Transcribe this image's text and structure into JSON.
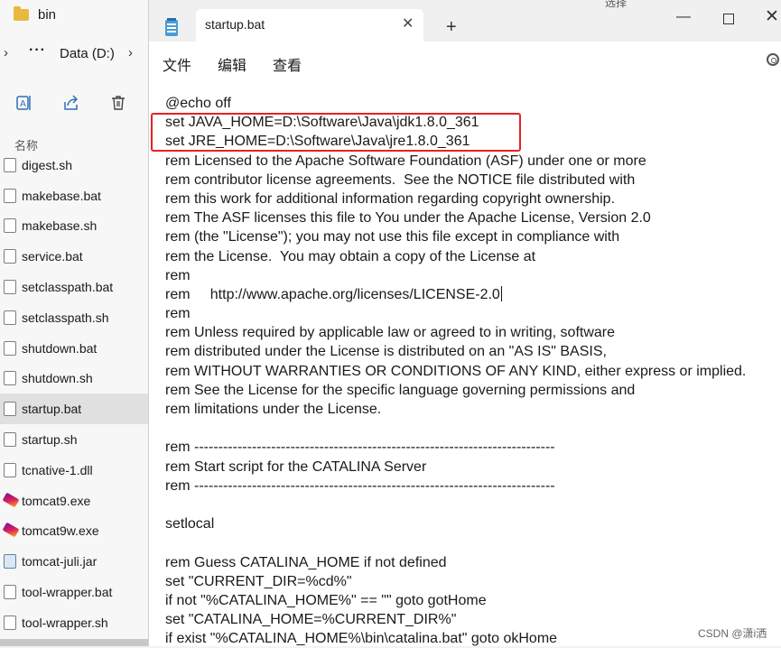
{
  "explorer": {
    "title": "bin",
    "breadcrumb": "Data (D:)",
    "breadcrumb_more": "···",
    "column_header": "名称",
    "selected_file": "startup.bat",
    "files": [
      {
        "name": "digest.sh",
        "type": "script"
      },
      {
        "name": "makebase.bat",
        "type": "script"
      },
      {
        "name": "makebase.sh",
        "type": "script"
      },
      {
        "name": "service.bat",
        "type": "script"
      },
      {
        "name": "setclasspath.bat",
        "type": "script"
      },
      {
        "name": "setclasspath.sh",
        "type": "script"
      },
      {
        "name": "shutdown.bat",
        "type": "script"
      },
      {
        "name": "shutdown.sh",
        "type": "script"
      },
      {
        "name": "startup.bat",
        "type": "script"
      },
      {
        "name": "startup.sh",
        "type": "script"
      },
      {
        "name": "tcnative-1.dll",
        "type": "dll"
      },
      {
        "name": "tomcat9.exe",
        "type": "exe"
      },
      {
        "name": "tomcat9w.exe",
        "type": "exe"
      },
      {
        "name": "tomcat-juli.jar",
        "type": "jar"
      },
      {
        "name": "tool-wrapper.bat",
        "type": "script"
      },
      {
        "name": "tool-wrapper.sh",
        "type": "script"
      }
    ]
  },
  "notepad": {
    "tab_title": "startup.bat",
    "peek_text": "选择",
    "menu": {
      "file": "文件",
      "edit": "编辑",
      "view": "查看"
    },
    "lines": [
      "@echo off",
      "set JAVA_HOME=D:\\Software\\Java\\jdk1.8.0_361",
      "set JRE_HOME=D:\\Software\\Java\\jre1.8.0_361",
      "rem Licensed to the Apache Software Foundation (ASF) under one or more",
      "rem contributor license agreements.  See the NOTICE file distributed with",
      "rem this work for additional information regarding copyright ownership.",
      "rem The ASF licenses this file to You under the Apache License, Version 2.0",
      "rem (the \"License\"); you may not use this file except in compliance with",
      "rem the License.  You may obtain a copy of the License at",
      "rem",
      "rem     http://www.apache.org/licenses/LICENSE-2.0",
      "rem",
      "rem Unless required by applicable law or agreed to in writing, software",
      "rem distributed under the License is distributed on an \"AS IS\" BASIS,",
      "rem WITHOUT WARRANTIES OR CONDITIONS OF ANY KIND, either express or implied.",
      "rem See the License for the specific language governing permissions and",
      "rem limitations under the License.",
      "",
      "rem ---------------------------------------------------------------------------",
      "rem Start script for the CATALINA Server",
      "rem ---------------------------------------------------------------------------",
      "",
      "setlocal",
      "",
      "rem Guess CATALINA_HOME if not defined",
      "set \"CURRENT_DIR=%cd%\"",
      "if not \"%CATALINA_HOME%\" == \"\" goto gotHome",
      "set \"CATALINA_HOME=%CURRENT_DIR%\"",
      "if exist \"%CATALINA_HOME%\\bin\\catalina.bat\" goto okHome"
    ],
    "caret_line": 10
  },
  "watermark": "CSDN @潇i洒"
}
